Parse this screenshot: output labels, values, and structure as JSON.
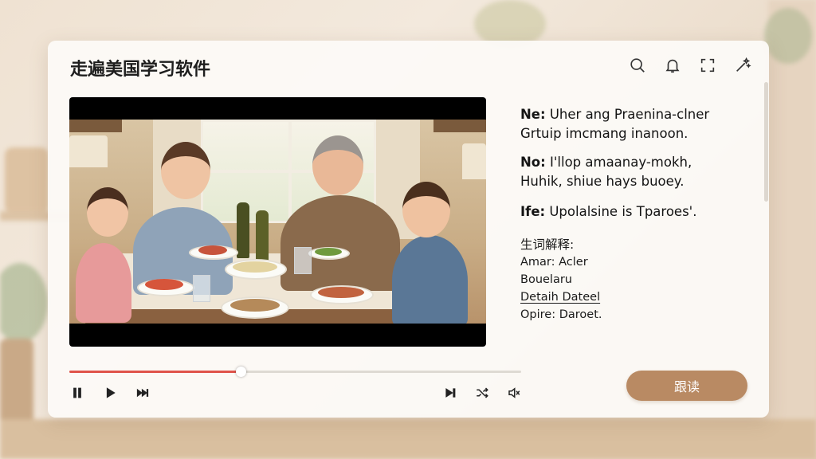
{
  "app": {
    "title": "走遍美国学习软件"
  },
  "toolbar": {
    "icons": [
      "search-icon",
      "bell-icon",
      "fullscreen-icon",
      "magic-icon"
    ]
  },
  "subtitles": [
    {
      "label": "Ne:",
      "line1": "Uher ang Praenina-clner",
      "line2": "Grtuip imcmang inanoon."
    },
    {
      "label": "No:",
      "line1": "I'llop amaanay-mokh,",
      "line2": "Huhik, shiue hays buoey."
    },
    {
      "label": "Ife:",
      "line1": "Upolalsine is Tparoes'."
    }
  ],
  "glossary": {
    "title": "生词解释:",
    "items": [
      "Amar: Acler",
      "Bouelaru",
      "Detaih Dateel",
      "Opire: Daroet."
    ]
  },
  "player": {
    "progress": 0.38,
    "follow_label": "跟读"
  },
  "colors": {
    "accent": "#e0534a",
    "button": "#b98a63"
  }
}
